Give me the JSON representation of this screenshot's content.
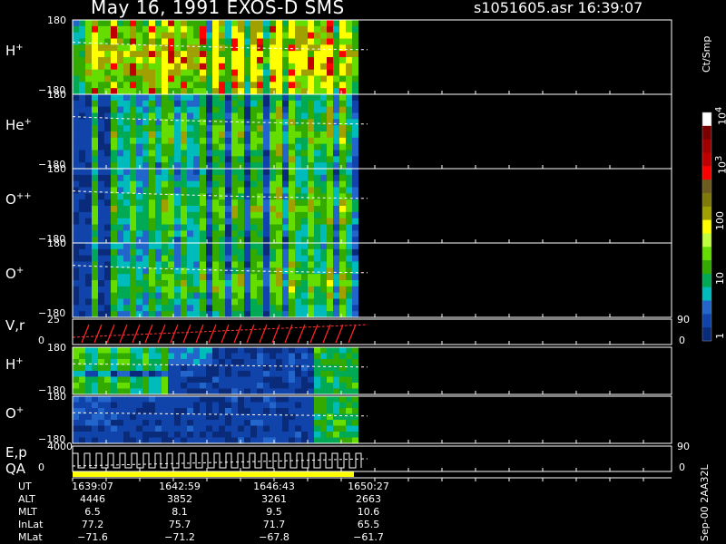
{
  "header": {
    "title": "May 16, 1991   EXOS-D SMS",
    "file": "s1051605.asr  16:39:07"
  },
  "chart_data": {
    "type": "heatmap",
    "title": "May 16, 1991   EXOS-D SMS",
    "panels": [
      {
        "label": "H",
        "sup": "+",
        "ytop": "180",
        "ybot": "−180"
      },
      {
        "label": "He",
        "sup": "+",
        "ytop": "180",
        "ybot": "−180"
      },
      {
        "label": "O",
        "sup": "++",
        "ytop": "180",
        "ybot": "−180"
      },
      {
        "label": "O",
        "sup": "+",
        "ytop": "180",
        "ybot": "−180"
      },
      {
        "label": "V,r",
        "sup": "",
        "ytop": "25",
        "ybot": "0",
        "right_top": "90",
        "right_bot": "0"
      },
      {
        "label": "H",
        "sup": "+",
        "ytop": "180",
        "ybot": "−180"
      },
      {
        "label": "O",
        "sup": "+",
        "ytop": "180",
        "ybot": "−180"
      },
      {
        "label": "E,p",
        "sup": "",
        "ytop": "4000",
        "ybot": "0",
        "right_top": "90",
        "right_bot": "0"
      }
    ],
    "qa_label": "QA",
    "colorbar": {
      "unit": "Ct/Smp",
      "ticks": [
        {
          "base": "10",
          "exp": "4"
        },
        {
          "base": "10",
          "exp": "3"
        },
        {
          "base": "100",
          "exp": ""
        },
        {
          "base": "10",
          "exp": ""
        },
        {
          "base": "1",
          "exp": ""
        }
      ],
      "colors": [
        "#ffffff",
        "#7a0000",
        "#a00000",
        "#c00000",
        "#ff0000",
        "#6e5c1e",
        "#7f7a0a",
        "#a0a000",
        "#ffff00",
        "#c0ff40",
        "#66dd00",
        "#33aa00",
        "#00aa55",
        "#00bbbb",
        "#2266cc",
        "#1144aa",
        "#0a2a7a"
      ]
    },
    "orbit": {
      "labels": [
        "UT",
        "ALT",
        "MLT",
        "InLat",
        "MLat"
      ],
      "columns": [
        [
          "1639:07",
          "4446",
          "6.5",
          "77.2",
          "−71.6"
        ],
        [
          "1642:59",
          "3852",
          "8.1",
          "75.7",
          "−71.2"
        ],
        [
          "1646:43",
          "3261",
          "9.5",
          "71.7",
          "−67.8"
        ],
        [
          "1650:27",
          "2663",
          "10.6",
          "65.5",
          "−61.7"
        ]
      ]
    }
  },
  "footer": "Sep-00  2AA32L"
}
